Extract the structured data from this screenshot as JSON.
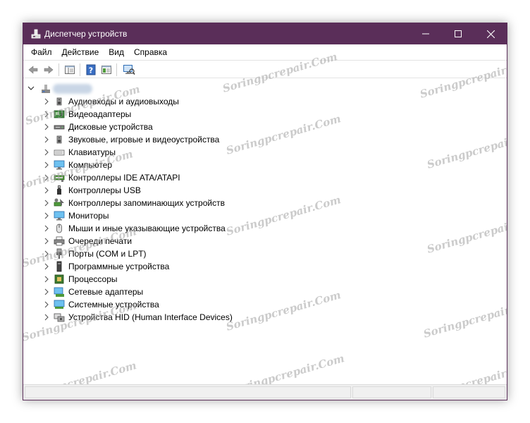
{
  "window": {
    "title": "Диспетчер устройств",
    "title_icon": "device-manager-icon",
    "controls": {
      "minimize": "minimize-icon",
      "maximize": "maximize-icon",
      "close": "close-icon"
    },
    "accent_color": "#5a2e59"
  },
  "menu": [
    {
      "label": "Файл"
    },
    {
      "label": "Действие"
    },
    {
      "label": "Вид"
    },
    {
      "label": "Справка"
    }
  ],
  "toolbar": [
    "back-arrow-icon",
    "forward-arrow-icon",
    "show-hide-console-tree-icon",
    "help-icon",
    "properties-icon",
    "scan-hardware-icon"
  ],
  "tree": {
    "root_state": "expanded",
    "categories": [
      {
        "label": "Аудиовходы и аудиовыходы",
        "icon": "speaker-icon"
      },
      {
        "label": "Видеоадаптеры",
        "icon": "display-adapter-icon"
      },
      {
        "label": "Дисковые устройства",
        "icon": "disk-drive-icon"
      },
      {
        "label": "Звуковые, игровые и видеоустройства",
        "icon": "sound-device-icon"
      },
      {
        "label": "Клавиатуры",
        "icon": "keyboard-icon"
      },
      {
        "label": "Компьютер",
        "icon": "computer-icon"
      },
      {
        "label": "Контроллеры IDE ATA/ATAPI",
        "icon": "ide-controller-icon"
      },
      {
        "label": "Контроллеры USB",
        "icon": "usb-icon"
      },
      {
        "label": "Контроллеры запоминающих устройств",
        "icon": "storage-controller-icon"
      },
      {
        "label": "Мониторы",
        "icon": "monitor-icon"
      },
      {
        "label": "Мыши и иные указывающие устройства",
        "icon": "mouse-icon"
      },
      {
        "label": "Очереди печати",
        "icon": "printer-icon"
      },
      {
        "label": "Порты (COM и LPT)",
        "icon": "port-icon"
      },
      {
        "label": "Программные устройства",
        "icon": "software-device-icon"
      },
      {
        "label": "Процессоры",
        "icon": "processor-icon"
      },
      {
        "label": "Сетевые адаптеры",
        "icon": "network-adapter-icon"
      },
      {
        "label": "Системные устройства",
        "icon": "system-device-icon"
      },
      {
        "label": "Устройства HID (Human Interface Devices)",
        "icon": "hid-icon"
      }
    ]
  },
  "watermark": "Soringpcrepair.Com"
}
